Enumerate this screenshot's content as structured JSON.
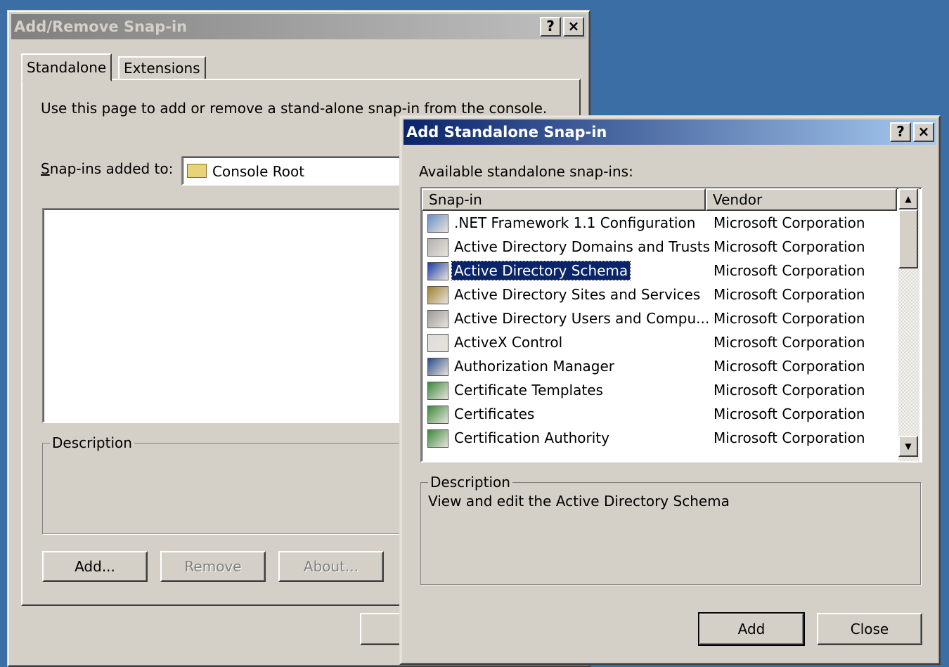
{
  "back_dialog": {
    "title": "Add/Remove Snap-in",
    "help_btn": "?",
    "close_btn": "×",
    "tabs": [
      "Standalone",
      "Extensions"
    ],
    "intro": "Use this page to add or remove a stand-alone snap-in from the console.",
    "added_to_label": "Snap-ins added to:",
    "added_to_value": "Console Root",
    "description_legend": "Description",
    "buttons": {
      "add": "Add...",
      "remove": "Remove",
      "about": "About..."
    }
  },
  "front_dialog": {
    "title": "Add Standalone Snap-in",
    "help_btn": "?",
    "close_btn": "×",
    "available_label": "Available standalone snap-ins:",
    "columns": {
      "snapin": "Snap-in",
      "vendor": "Vendor"
    },
    "items": [
      {
        "name": ".NET Framework 1.1 Configuration",
        "vendor": "Microsoft Corporation",
        "icon": "dotnet-config-icon"
      },
      {
        "name": "Active Directory Domains and Trusts",
        "vendor": "Microsoft Corporation",
        "icon": "ad-domains-icon"
      },
      {
        "name": "Active Directory Schema",
        "vendor": "Microsoft Corporation",
        "icon": "ad-schema-icon",
        "selected": true
      },
      {
        "name": "Active Directory Sites and Services",
        "vendor": "Microsoft Corporation",
        "icon": "ad-sites-icon"
      },
      {
        "name": "Active Directory Users and Compu...",
        "vendor": "Microsoft Corporation",
        "icon": "ad-users-icon"
      },
      {
        "name": "ActiveX Control",
        "vendor": "Microsoft Corporation",
        "icon": "activex-icon"
      },
      {
        "name": "Authorization Manager",
        "vendor": "Microsoft Corporation",
        "icon": "authorization-manager-icon"
      },
      {
        "name": "Certificate Templates",
        "vendor": "Microsoft Corporation",
        "icon": "certificate-templates-icon"
      },
      {
        "name": "Certificates",
        "vendor": "Microsoft Corporation",
        "icon": "certificates-icon"
      },
      {
        "name": "Certification Authority",
        "vendor": "Microsoft Corporation",
        "icon": "certification-authority-icon"
      }
    ],
    "description_legend": "Description",
    "description_text": "View and edit the Active Directory Schema",
    "buttons": {
      "add": "Add",
      "close": "Close"
    }
  },
  "colors": {
    "desktop": "#3a6ea5",
    "face": "#d4d0c8",
    "selection": "#0a246a"
  }
}
